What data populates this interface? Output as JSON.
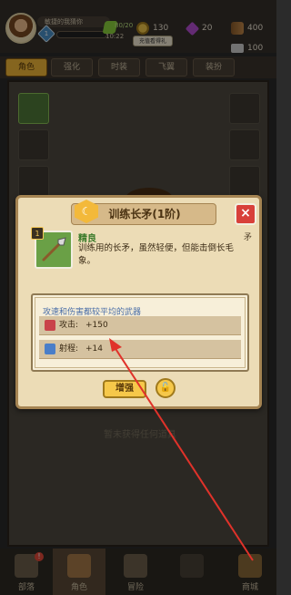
{
  "header": {
    "player_name": "敏捷的我猜你",
    "level": "1",
    "energy": "80/20",
    "timer": "10:22",
    "coins": "130",
    "gems": "20",
    "wood": "400",
    "iron": "100",
    "gold_button_label": "充值看得礼"
  },
  "tabs": [
    {
      "label": "角色"
    },
    {
      "label": "强化"
    },
    {
      "label": "时装"
    },
    {
      "label": "飞翼"
    },
    {
      "label": "装扮"
    }
  ],
  "scene": {
    "empty_text": "暂未获得任何道具"
  },
  "modal": {
    "title": "训练长矛(1阶)",
    "title_badge": "☾",
    "close_label": "×",
    "item_level": "1",
    "quality": "精良",
    "type": "矛",
    "description": "训练用的长矛，虽然轻便，但能击倒长毛象。",
    "summary": "攻速和伤害都较平均的武器",
    "stats": [
      {
        "label": "攻击:",
        "value": "+150",
        "color": "#c9424a"
      },
      {
        "label": "射程:",
        "value": "+14",
        "color": "#4a7ec8"
      }
    ],
    "upgrade_label": "增强",
    "lock_icon": "🔓"
  },
  "nav": [
    {
      "label": "部落"
    },
    {
      "label": "角色"
    },
    {
      "label": "冒险"
    },
    {
      "label": ""
    },
    {
      "label": "商城"
    }
  ],
  "colors": {
    "accent_gold": "#f3b93a",
    "close_red": "#d8403a",
    "annotation_red": "#e0322a"
  }
}
